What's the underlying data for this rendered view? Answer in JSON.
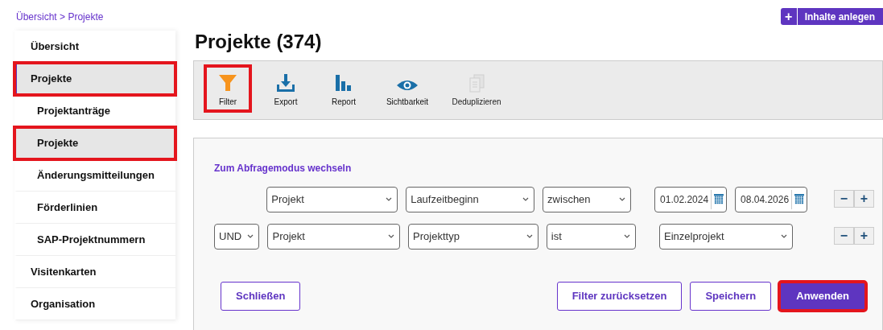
{
  "breadcrumb": [
    {
      "label": "Übersicht"
    },
    {
      "label": "Projekte"
    }
  ],
  "breadcrumb_separator": ">",
  "create_button": {
    "icon": "+",
    "label": "Inhalte anlegen"
  },
  "sidebar": {
    "items": [
      {
        "label": "Übersicht",
        "selected": false,
        "highlighted": false
      },
      {
        "label": "Projekte",
        "selected": true,
        "highlighted": true,
        "children": [
          {
            "label": "Projektanträge",
            "selected": false,
            "highlighted": false
          },
          {
            "label": "Projekte",
            "selected": true,
            "highlighted": true
          },
          {
            "label": "Änderungsmitteilungen",
            "selected": false,
            "highlighted": false
          },
          {
            "label": "Förderlinien",
            "selected": false,
            "highlighted": false
          },
          {
            "label": "SAP-Projektnummern",
            "selected": false,
            "highlighted": false
          }
        ]
      },
      {
        "label": "Visitenkarten",
        "selected": false,
        "highlighted": false
      },
      {
        "label": "Organisation",
        "selected": false,
        "highlighted": false
      }
    ]
  },
  "page_title": "Projekte (374)",
  "toolbar": [
    {
      "kind": "filter",
      "label": "Filter",
      "highlighted": true,
      "disabled": false
    },
    {
      "kind": "export",
      "label": "Export",
      "highlighted": false,
      "disabled": false
    },
    {
      "kind": "report",
      "label": "Report",
      "highlighted": false,
      "disabled": false
    },
    {
      "kind": "visibility",
      "label": "Sichtbarkeit",
      "highlighted": false,
      "disabled": false
    },
    {
      "kind": "deduplicate",
      "label": "Deduplizieren",
      "highlighted": false,
      "disabled": true
    }
  ],
  "filter": {
    "mode_link": "Zum Abfragemodus wechseln",
    "rows": [
      {
        "kind": "date-range",
        "entity": "Projekt",
        "field": "Laufzeitbeginn",
        "operator": "zwischen",
        "values": [
          "01.02.2024",
          "08.04.2026"
        ]
      },
      {
        "kind": "select",
        "connector": "UND",
        "entity": "Projekt",
        "field": "Projekttyp",
        "operator": "ist",
        "value": "Einzelprojekt"
      }
    ],
    "row_actions": [
      "−",
      "+"
    ],
    "buttons": [
      {
        "kind": "secondary",
        "label": "Schließen",
        "highlighted": false
      },
      {
        "kind": "secondary",
        "label": "Filter zurücksetzen",
        "highlighted": false
      },
      {
        "kind": "secondary",
        "label": "Speichern",
        "highlighted": false
      },
      {
        "kind": "primary",
        "label": "Anwenden",
        "highlighted": true
      }
    ]
  }
}
